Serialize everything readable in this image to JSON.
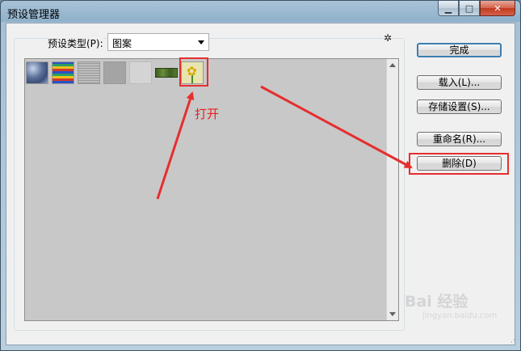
{
  "window": {
    "title": "预设管理器",
    "controls": {
      "minimize": "▁",
      "maximize": "□",
      "close": "✕"
    }
  },
  "preset_type": {
    "label": "预设类型(P):",
    "selected": "图案"
  },
  "presets": [
    {
      "name": "bubbles-pattern"
    },
    {
      "name": "color-stripes-pattern"
    },
    {
      "name": "gray-texture-pattern"
    },
    {
      "name": "gray-solid-pattern"
    },
    {
      "name": "light-gray-pattern"
    },
    {
      "name": "grass-pattern"
    },
    {
      "name": "sunflower-pattern"
    }
  ],
  "buttons": {
    "done": "完成",
    "load": "载入(L)...",
    "save": "存储设置(S)...",
    "rename": "重命名(R)...",
    "delete": "删除(D)"
  },
  "annotation": {
    "text": "打开",
    "color": "#e82020"
  },
  "watermark": {
    "main": "Bai 经验",
    "sub": "jingyan.baidu.com"
  },
  "colors": {
    "highlight": "#e62e2e",
    "accent": "#3c7fb1"
  }
}
